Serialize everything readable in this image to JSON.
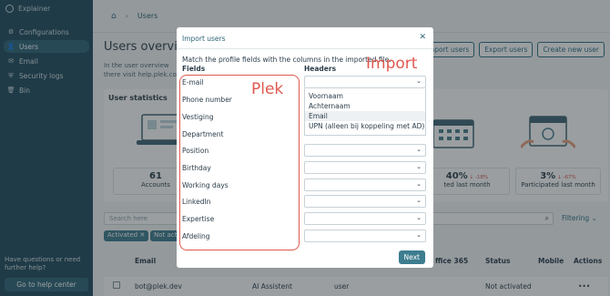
{
  "sidebar": {
    "brand": "Explainer",
    "items": [
      {
        "label": "Configurations",
        "icon": "gear-icon"
      },
      {
        "label": "Users",
        "icon": "user-icon",
        "active": true
      },
      {
        "label": "Email",
        "icon": "mail-icon"
      },
      {
        "label": "Security logs",
        "icon": "shield-icon"
      },
      {
        "label": "Bin",
        "icon": "trash-icon"
      }
    ],
    "help_text": "Have questions or need further help?",
    "help_button": "Go to help center"
  },
  "header": {
    "breadcrumb": "Users"
  },
  "page": {
    "title": "Users overview",
    "description": "In the user overview there visit help.plek.co",
    "buttons": [
      "Import users",
      "Export users",
      "Create new user"
    ]
  },
  "stats": {
    "title": "User statistics",
    "boxes": [
      {
        "value": "61",
        "label": "Accounts",
        "change": ""
      },
      {
        "value": "40%",
        "label": "ted last month",
        "change": "↓ -18%"
      },
      {
        "value": "3%",
        "label": "Participated last month",
        "change": "↓ -67%"
      }
    ]
  },
  "filters": {
    "search_placeholder": "Search here",
    "filtering_label": "Filtering",
    "chips": [
      "Activated",
      "Not activ"
    ]
  },
  "table": {
    "headers": [
      "Email",
      "ffice 365",
      "Status",
      "Mobile",
      "Actions"
    ],
    "rows": [
      {
        "email": "bot@plek.dev",
        "name": "AI Assistent",
        "role": "user",
        "status": "Not activated",
        "actions": "•••"
      }
    ]
  },
  "modal": {
    "title": "Import users",
    "description": "Match the profile fields with the columns in the imported file.",
    "fields_header": "Fields",
    "headers_header": "Headers",
    "fields": [
      "E-mail",
      "Phone number",
      "Vestiging",
      "Department",
      "Position",
      "Birthday",
      "Working days",
      "LinkedIn",
      "Expertise",
      "Afdeling"
    ],
    "dropdown_options": [
      "Voornaam",
      "Achternaam",
      "Email",
      "UPN (alleen bij koppeling met AD)"
    ],
    "highlighted_option": "Email",
    "next_button": "Next"
  },
  "annotations": {
    "left_label": "Plek",
    "right_label": "Import",
    "color": "#e0584f"
  }
}
